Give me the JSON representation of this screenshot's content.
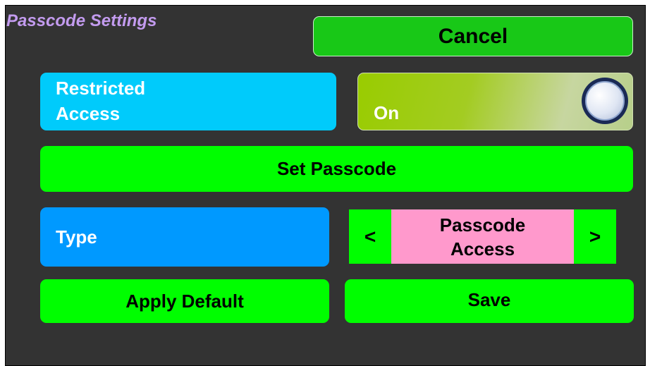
{
  "header": {
    "title": "Passcode Settings"
  },
  "actions": {
    "cancel_label": "Cancel",
    "apply_default_label": "Apply Default",
    "save_label": "Save"
  },
  "restricted_access": {
    "label": "Restricted\nAccess",
    "toggle_state": "On",
    "toggle_icon": "toggle-knob-icon"
  },
  "set_passcode": {
    "label": "Set Passcode"
  },
  "type": {
    "label": "Type",
    "selector": {
      "prev": "<",
      "value": "Passcode\nAccess",
      "next": ">"
    }
  },
  "colors": {
    "background": "#333333",
    "title": "#c39bef",
    "primary_green": "#00fe00",
    "cancel_green": "#18c817",
    "restricted_blue": "#00cbfb",
    "type_blue": "#0099ff",
    "toggle_green": "#99cc00",
    "selector_pink": "#ff99cc"
  }
}
